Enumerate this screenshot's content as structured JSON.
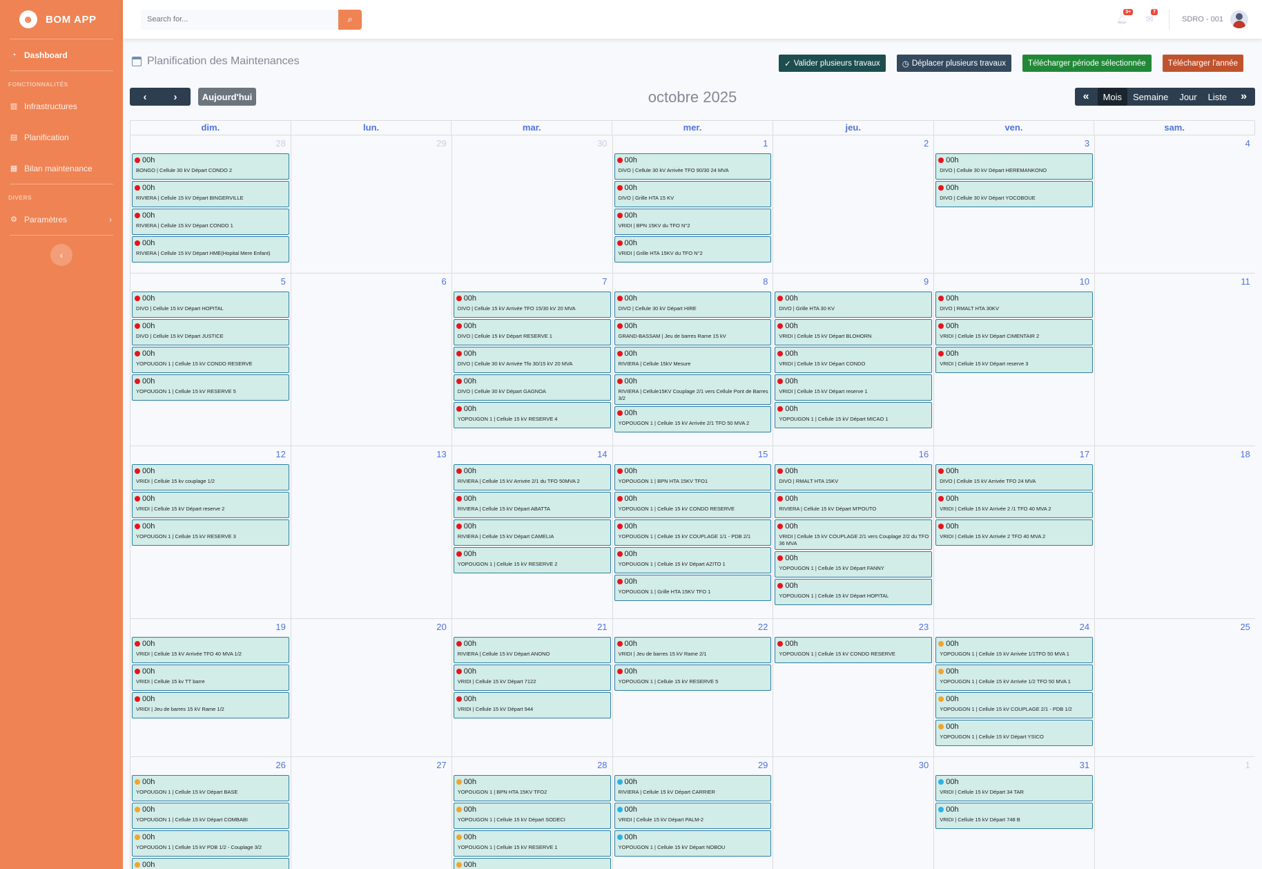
{
  "app": {
    "brand": "BOM APP",
    "logo_glyph": "☻"
  },
  "sidebar": {
    "dashboard": "Dashboard",
    "section_functions": "FONCTIONNALITÉS",
    "infrastructures": "Infrastructures",
    "planification": "Planification",
    "bilan": "Bilan maintenance",
    "section_divers": "DIVERS",
    "parametres": "Paramètres"
  },
  "topbar": {
    "search_placeholder": "Search for...",
    "alerts_badge": "3+",
    "messages_badge": "7",
    "user": "SDRO - 001"
  },
  "page": {
    "title": "Planification des Maintenances",
    "actions": {
      "validate": "Valider plusieurs travaux",
      "move": "Déplacer plusieurs travaux",
      "download_period": "Télécharger période sélectionnée",
      "download_year": "Télécharger l'année"
    }
  },
  "calendar": {
    "today_label": "Aujourd'hui",
    "title": "octobre 2025",
    "views": {
      "month": "Mois",
      "week": "Semaine",
      "day": "Jour",
      "list": "Liste"
    },
    "weekdays": [
      "dim.",
      "lun.",
      "mar.",
      "mer.",
      "jeu.",
      "ven.",
      "sam."
    ],
    "status_colors": {
      "red": "#e8141b",
      "orange": "#f0a52b",
      "blue": "#2ab2e7"
    },
    "weeks": [
      [
        {
          "day": "28",
          "other": true,
          "events": [
            {
              "time": "00h",
              "status": "red",
              "title": "BONGO | Cellule 30 kV Départ CONDO 2"
            },
            {
              "time": "00h",
              "status": "red",
              "title": "RIVIERA | Cellule 15 kV Départ BINGERVILLE"
            },
            {
              "time": "00h",
              "status": "red",
              "title": "RIVIERA | Cellule 15 kV Départ CONDO 1"
            },
            {
              "time": "00h",
              "status": "red",
              "title": "RIVIERA | Cellule 15 kV Départ HME(Hopital Mere Enfant)"
            }
          ]
        },
        {
          "day": "29",
          "other": true,
          "events": []
        },
        {
          "day": "30",
          "other": true,
          "events": []
        },
        {
          "day": "1",
          "events": [
            {
              "time": "00h",
              "status": "red",
              "title": "DIVO | Cellule 30 kV Arrivée TFO 90/30 24 MVA"
            },
            {
              "time": "00h",
              "status": "red",
              "title": "DIVO | Grille HTA 15 KV"
            },
            {
              "time": "00h",
              "status": "red",
              "title": "VRIDI | BPN 15KV du TFO N°2"
            },
            {
              "time": "00h",
              "status": "red",
              "title": "VRIDI | Grille HTA 15KV du TFO N°2"
            }
          ]
        },
        {
          "day": "2",
          "events": []
        },
        {
          "day": "3",
          "events": [
            {
              "time": "00h",
              "status": "red",
              "title": "DIVO | Cellule 30 kV Départ HEREMANKONO"
            },
            {
              "time": "00h",
              "status": "red",
              "title": "DIVO | Cellule 30 kV Départ YOCOBOUE"
            }
          ]
        },
        {
          "day": "4",
          "events": []
        }
      ],
      [
        {
          "day": "5",
          "events": [
            {
              "time": "00h",
              "status": "red",
              "title": "DIVO | Cellule 15 kV Départ HOPITAL"
            },
            {
              "time": "00h",
              "status": "red",
              "title": "DIVO | Cellule 15 kV Départ JUSTICE"
            },
            {
              "time": "00h",
              "status": "red",
              "title": "YOPOUGON 1 | Cellule 15 kV CONDO RESERVE"
            },
            {
              "time": "00h",
              "status": "red",
              "title": "YOPOUGON 1 | Cellule 15 kV RESERVE 5"
            }
          ]
        },
        {
          "day": "6",
          "events": []
        },
        {
          "day": "7",
          "events": [
            {
              "time": "00h",
              "status": "red",
              "title": "DIVO | Cellule 15 kV Arrivée TFO 15/30 kV 20 MVA"
            },
            {
              "time": "00h",
              "status": "red",
              "title": "DIVO | Cellule 15 kV Départ RESERVE 1"
            },
            {
              "time": "00h",
              "status": "red",
              "title": "DIVO | Cellule 30 kV Arrivée Tfo 30/15 kV 20 MVA"
            },
            {
              "time": "00h",
              "status": "red",
              "title": "DIVO | Cellule 30 kV Départ GAGNOA"
            },
            {
              "time": "00h",
              "status": "red",
              "title": "YOPOUGON 1 | Cellule 15 kV RESERVE 4"
            }
          ]
        },
        {
          "day": "8",
          "events": [
            {
              "time": "00h",
              "status": "red",
              "title": "DIVO | Cellule 30 kV Départ HIRE"
            },
            {
              "time": "00h",
              "status": "red",
              "title": "GRAND-BASSAM | Jeu de barres Rame 15 kV"
            },
            {
              "time": "00h",
              "status": "red",
              "title": "RIVIERA | Cellule 15kV Mesure"
            },
            {
              "time": "00h",
              "status": "red",
              "title": "RIVIERA | Cellule15KV Couplage 2/1 vers Cellule Pont de Barres 3/2"
            },
            {
              "time": "00h",
              "status": "red",
              "title": "YOPOUGON 1 | Cellule 15 kV Arrivée 2/1 TFO 50 MVA 2"
            }
          ]
        },
        {
          "day": "9",
          "events": [
            {
              "time": "00h",
              "status": "red",
              "title": "DIVO | Grille HTA 30 KV"
            },
            {
              "time": "00h",
              "status": "red",
              "title": "VRIDI | Cellule 15 kV Départ BLOHORN"
            },
            {
              "time": "00h",
              "status": "red",
              "title": "VRIDI | Cellule 15 kV Départ CONDO"
            },
            {
              "time": "00h",
              "status": "red",
              "title": "VRIDI | Cellule 15 kV Départ reserve 1"
            },
            {
              "time": "00h",
              "status": "red",
              "title": "YOPOUGON 1 | Cellule 15 kV Départ MICAO 1"
            }
          ]
        },
        {
          "day": "10",
          "events": [
            {
              "time": "00h",
              "status": "red",
              "title": "DIVO | RMALT HTA 30KV"
            },
            {
              "time": "00h",
              "status": "red",
              "title": "VRIDI | Cellule 15 kV Départ CIMENTAIR 2"
            },
            {
              "time": "00h",
              "status": "red",
              "title": "VRIDI | Cellule 15 kV Départ reserve 3"
            }
          ]
        },
        {
          "day": "11",
          "events": []
        }
      ],
      [
        {
          "day": "12",
          "events": [
            {
              "time": "00h",
              "status": "red",
              "title": "VRIDI | Cellule 15 kv couplage 1/2"
            },
            {
              "time": "00h",
              "status": "red",
              "title": "VRIDI | Cellule 15 kV Départ reserve 2"
            },
            {
              "time": "00h",
              "status": "red",
              "title": "YOPOUGON 1 | Cellule 15 kV RESERVE 3"
            }
          ]
        },
        {
          "day": "13",
          "events": []
        },
        {
          "day": "14",
          "events": [
            {
              "time": "00h",
              "status": "red",
              "title": "RIVIERA | Cellule 15 kV Arrivée 2/1 du TFO 50MVA 2"
            },
            {
              "time": "00h",
              "status": "red",
              "title": "RIVIERA | Cellule 15 kV Départ ABATTA"
            },
            {
              "time": "00h",
              "status": "red",
              "title": "RIVIERA | Cellule 15 kV Départ CAMELIA"
            },
            {
              "time": "00h",
              "status": "red",
              "title": "YOPOUGON 1 | Cellule 15 kV RESERVE 2"
            }
          ]
        },
        {
          "day": "15",
          "events": [
            {
              "time": "00h",
              "status": "red",
              "title": "YOPOUGON 1 | BPN HTA 15KV TFO1"
            },
            {
              "time": "00h",
              "status": "red",
              "title": "YOPOUGON 1 | Cellule 15 kV CONDO RESERVE"
            },
            {
              "time": "00h",
              "status": "red",
              "title": "YOPOUGON 1 | Cellule 15 kV COUPLAGE 1/1 - PDB 2/1"
            },
            {
              "time": "00h",
              "status": "red",
              "title": "YOPOUGON 1 | Cellule 15 kV Départ AZITO 1"
            },
            {
              "time": "00h",
              "status": "red",
              "title": "YOPOUGON 1 | Grille HTA 15KV TFO 1"
            }
          ]
        },
        {
          "day": "16",
          "events": [
            {
              "time": "00h",
              "status": "red",
              "title": "DIVO | RMALT HTA 15KV"
            },
            {
              "time": "00h",
              "status": "red",
              "title": "RIVIERA | Cellule 15 kV Départ M'POUTO"
            },
            {
              "time": "00h",
              "status": "red",
              "title": "VRIDI | Cellule 15 kV COUPLAGE 2/1 vers Couplage 2/2 du TFO 36 MVA"
            },
            {
              "time": "00h",
              "status": "red",
              "title": "YOPOUGON 1 | Cellule 15 kV Départ FANNY"
            },
            {
              "time": "00h",
              "status": "red",
              "title": "YOPOUGON 1 | Cellule 15 kV Départ HOPITAL"
            }
          ]
        },
        {
          "day": "17",
          "events": [
            {
              "time": "00h",
              "status": "red",
              "title": "DIVO | Cellule 15 kV Arrivée TFO 24 MVA"
            },
            {
              "time": "00h",
              "status": "red",
              "title": "VRIDI | Cellule 15 kV Arrivée 2 /1 TFO 40 MVA 2"
            },
            {
              "time": "00h",
              "status": "red",
              "title": "VRIDI | Cellule 15 kV Arrivée 2 TFO 40 MVA 2"
            }
          ]
        },
        {
          "day": "18",
          "events": []
        }
      ],
      [
        {
          "day": "19",
          "events": [
            {
              "time": "00h",
              "status": "red",
              "title": "VRIDI | Cellule 15 kV Arrivée TFO 40 MVA 1/2"
            },
            {
              "time": "00h",
              "status": "red",
              "title": "VRIDI | Cellule 15 kv TT barre"
            },
            {
              "time": "00h",
              "status": "red",
              "title": "VRIDI | Jeu de barres 15 kV Rame 1/2"
            }
          ]
        },
        {
          "day": "20",
          "events": []
        },
        {
          "day": "21",
          "events": [
            {
              "time": "00h",
              "status": "red",
              "title": "RIVIERA | Cellule 15 kV Départ ANONO"
            },
            {
              "time": "00h",
              "status": "red",
              "title": "VRIDI | Cellule 15 kV Départ 7122"
            },
            {
              "time": "00h",
              "status": "red",
              "title": "VRIDI | Cellule 15 kV Départ 944"
            }
          ]
        },
        {
          "day": "22",
          "events": [
            {
              "time": "00h",
              "status": "red",
              "title": "VRIDI | Jeu de barres 15 kV Rame 2/1"
            },
            {
              "time": "00h",
              "status": "red",
              "title": "YOPOUGON 1 | Cellule 15 kV RESERVE 5"
            }
          ]
        },
        {
          "day": "23",
          "events": [
            {
              "time": "00h",
              "status": "red",
              "title": "YOPOUGON 1 | Cellule 15 kV CONDO RESERVE"
            }
          ]
        },
        {
          "day": "24",
          "events": [
            {
              "time": "00h",
              "status": "orange",
              "title": "YOPOUGON 1 | Cellule 15 kV Arrivée 1/1TFO 50 MVA 1"
            },
            {
              "time": "00h",
              "status": "orange",
              "title": "YOPOUGON 1 | Cellule 15 kV Arrivée 1/2 TFO 50 MVA 1"
            },
            {
              "time": "00h",
              "status": "orange",
              "title": "YOPOUGON 1 | Cellule 15 kV COUPLAGE 2/1 - PDB 1/2"
            },
            {
              "time": "00h",
              "status": "orange",
              "title": "YOPOUGON 1 | Cellule 15 kV Départ YSICO"
            }
          ]
        },
        {
          "day": "25",
          "events": []
        }
      ],
      [
        {
          "day": "26",
          "events": [
            {
              "time": "00h",
              "status": "orange",
              "title": "YOPOUGON 1 | Cellule 15 kV Départ BASE"
            },
            {
              "time": "00h",
              "status": "orange",
              "title": "YOPOUGON 1 | Cellule 15 kV Départ COMBABI"
            },
            {
              "time": "00h",
              "status": "orange",
              "title": "YOPOUGON 1 | Cellule 15 kV PDB 1/2 - Couplage 3/2"
            },
            {
              "time": "00h",
              "status": "orange",
              "title": ""
            }
          ]
        },
        {
          "day": "27",
          "events": []
        },
        {
          "day": "28",
          "events": [
            {
              "time": "00h",
              "status": "orange",
              "title": "YOPOUGON 1 | BPN HTA 15KV TFO2"
            },
            {
              "time": "00h",
              "status": "orange",
              "title": "YOPOUGON 1 | Cellule 15 kV Départ SODECI"
            },
            {
              "time": "00h",
              "status": "orange",
              "title": "YOPOUGON 1 | Cellule 15 kV RESERVE 1"
            },
            {
              "time": "00h",
              "status": "orange",
              "title": ""
            }
          ]
        },
        {
          "day": "29",
          "events": [
            {
              "time": "00h",
              "status": "blue",
              "title": "RIVIERA | Cellule 15 kV Départ CARRIER"
            },
            {
              "time": "00h",
              "status": "blue",
              "title": "VRIDI | Cellule 15 kV Départ PALM-2"
            },
            {
              "time": "00h",
              "status": "blue",
              "title": "YOPOUGON 1 | Cellule 15 kV Départ NOBOU"
            }
          ]
        },
        {
          "day": "30",
          "events": []
        },
        {
          "day": "31",
          "events": [
            {
              "time": "00h",
              "status": "blue",
              "title": "VRIDI | Cellule 15 kV Départ 34 TAR"
            },
            {
              "time": "00h",
              "status": "blue",
              "title": "VRIDI | Cellule 15 kV Départ 748 B"
            }
          ]
        },
        {
          "day": "1",
          "other": true,
          "events": []
        }
      ]
    ]
  }
}
